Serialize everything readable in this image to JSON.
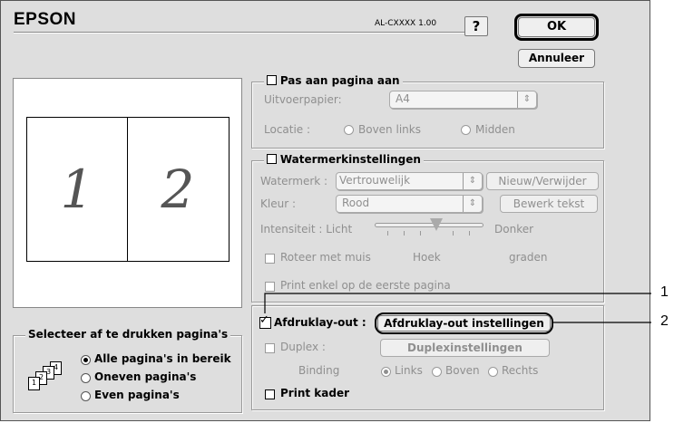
{
  "header": {
    "brand": "EPSON",
    "model": "AL-CXXXX 1.00",
    "help_label": "?",
    "ok_label": "OK",
    "cancel_label": "Annuleer"
  },
  "preview": {
    "page1": "1",
    "page2": "2"
  },
  "fit_page": {
    "label": "Pas aan pagina aan",
    "checked": false,
    "paper_label": "Uitvoerpapier:",
    "paper_value": "A4",
    "location_label": "Locatie :",
    "opt_top_left": "Boven links",
    "opt_center": "Midden"
  },
  "watermark": {
    "label": "Watermerkinstellingen",
    "checked": false,
    "wm_label": "Watermerk :",
    "wm_value": "Vertrouwelijk",
    "new_delete": "Nieuw/Verwijder",
    "color_label": "Kleur :",
    "color_value": "Rood",
    "edit_text": "Bewerk tekst",
    "intensity_label": "Intensiteit : Licht",
    "intensity_dark": "Donker",
    "intensity_value": 0.5,
    "rotate_label": "Roteer met muis",
    "angle_label": "Hoek",
    "degrees_label": "graden",
    "first_page_label": "Print enkel op de eerste pagina"
  },
  "layout": {
    "label": "Afdruklay-out :",
    "checked": true,
    "settings_button": "Afdruklay-out instellingen",
    "duplex_label": "Duplex :",
    "duplex_button": "Duplexinstellingen",
    "binding_label": "Binding",
    "bind_left": "Links",
    "bind_top": "Boven",
    "bind_right": "Rechts",
    "print_frame": "Print kader"
  },
  "page_select": {
    "title": "Selecteer af te drukken pagina's",
    "opt_all": "Alle pagina's in bereik",
    "opt_odd": "Oneven pagina's",
    "opt_even": "Even pagina's",
    "icon_pages": [
      "1",
      "2",
      "3",
      "4"
    ]
  },
  "callouts": {
    "one": "1",
    "two": "2"
  }
}
